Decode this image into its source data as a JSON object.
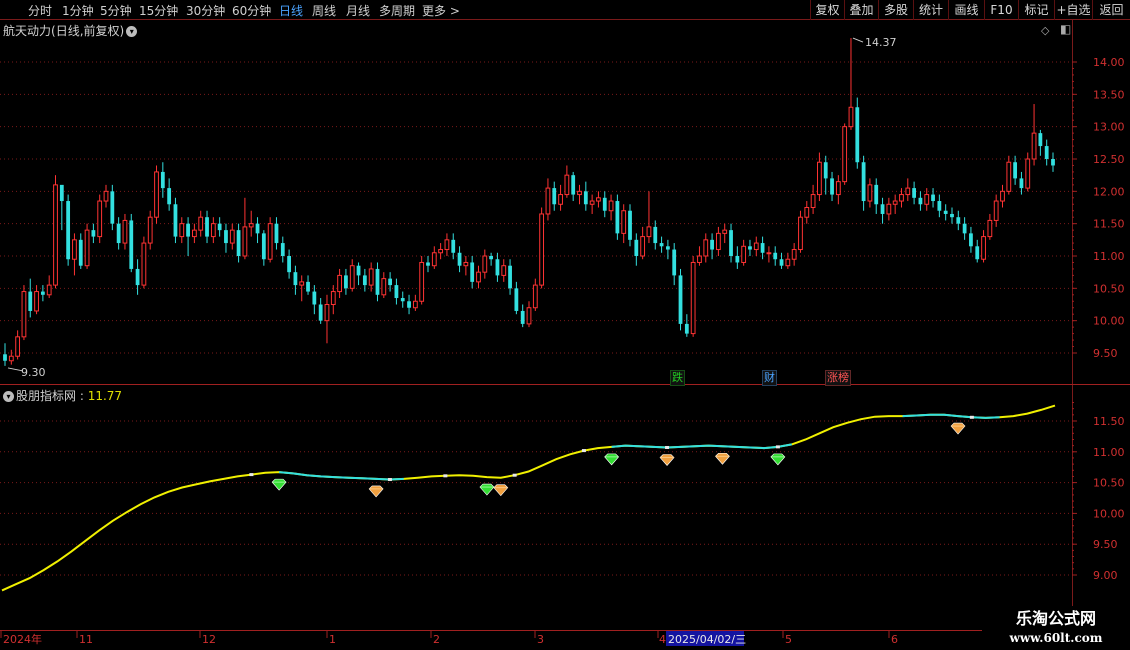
{
  "toolbar": {
    "periods": [
      "分时",
      "1分钟",
      "5分钟",
      "15分钟",
      "30分钟",
      "60分钟",
      "日线",
      "周线",
      "月线",
      "多周期",
      "更多 >"
    ],
    "active_period": "日线",
    "buttons": [
      "复权",
      "叠加",
      "多股",
      "统计",
      "画线",
      "F10",
      "标记",
      "+自选",
      "返回"
    ]
  },
  "main_chart": {
    "stock_name": "航天动力",
    "period_info": "(日线,前复权)",
    "high_label": "14.37",
    "low_label": "9.30",
    "y_ticks": [
      "14.00",
      "13.50",
      "13.00",
      "12.50",
      "12.00",
      "11.50",
      "11.00",
      "10.50",
      "10.00",
      "9.50"
    ],
    "tags": [
      {
        "text": "跌",
        "color": "#22cc22"
      },
      {
        "text": "财",
        "color": "#4aa3ff"
      },
      {
        "text": "涨榜",
        "color": "#ff5555"
      }
    ]
  },
  "indicator": {
    "name": "股朋指标网",
    "value": "11.77",
    "y_ticks": [
      "11.50",
      "11.00",
      "10.50",
      "10.00",
      "9.50",
      "9.00"
    ]
  },
  "x_axis": {
    "labels": [
      "2024年",
      "11",
      "12",
      "1",
      "2",
      "3",
      "4",
      "5",
      "6"
    ],
    "cursor_date": "2025/04/02/三"
  },
  "watermark": {
    "main": "乐淘公式网",
    "url": "www.60lt.com"
  },
  "colors": {
    "up": "#ff3333",
    "down": "#33e0e0",
    "line_yellow": "#f0f000",
    "line_cyan": "#33e0e0",
    "grid": "#7a1a1a"
  },
  "chart_data": {
    "type": "candlestick",
    "price_range": [
      9.2,
      14.6
    ],
    "high": 14.37,
    "low": 9.3,
    "candles": [
      [
        9.48,
        9.38,
        9.65,
        9.3
      ],
      [
        9.38,
        9.45,
        9.55,
        9.32
      ],
      [
        9.45,
        9.75,
        9.85,
        9.4
      ],
      [
        9.75,
        10.45,
        10.55,
        9.7
      ],
      [
        10.45,
        10.15,
        10.65,
        10.05
      ],
      [
        10.15,
        10.45,
        10.55,
        10.1
      ],
      [
        10.45,
        10.4,
        10.55,
        10.3
      ],
      [
        10.4,
        10.55,
        10.7,
        10.35
      ],
      [
        10.55,
        12.1,
        12.25,
        10.5
      ],
      [
        12.1,
        11.85,
        12.0,
        11.4
      ],
      [
        11.85,
        10.95,
        11.95,
        10.85
      ],
      [
        10.95,
        11.25,
        11.35,
        10.7
      ],
      [
        11.25,
        10.85,
        11.35,
        10.8
      ],
      [
        10.85,
        11.4,
        11.5,
        10.8
      ],
      [
        11.4,
        11.3,
        11.5,
        11.2
      ],
      [
        11.3,
        11.85,
        11.95,
        11.2
      ],
      [
        11.85,
        12.0,
        12.1,
        11.75
      ],
      [
        12.0,
        11.5,
        12.1,
        11.4
      ],
      [
        11.5,
        11.2,
        11.6,
        11.1
      ],
      [
        11.2,
        11.55,
        11.65,
        11.1
      ],
      [
        11.55,
        10.8,
        11.65,
        10.75
      ],
      [
        10.8,
        10.55,
        10.95,
        10.4
      ],
      [
        10.55,
        11.2,
        11.3,
        10.5
      ],
      [
        11.2,
        11.6,
        11.7,
        11.1
      ],
      [
        11.6,
        12.3,
        12.4,
        11.5
      ],
      [
        12.3,
        12.05,
        12.45,
        11.9
      ],
      [
        12.05,
        11.8,
        12.2,
        11.7
      ],
      [
        11.8,
        11.3,
        11.9,
        11.2
      ],
      [
        11.3,
        11.5,
        11.6,
        11.2
      ],
      [
        11.5,
        11.3,
        11.6,
        11.0
      ],
      [
        11.3,
        11.4,
        11.5,
        11.2
      ],
      [
        11.4,
        11.6,
        11.7,
        11.3
      ],
      [
        11.6,
        11.3,
        11.7,
        11.2
      ],
      [
        11.3,
        11.5,
        11.6,
        11.2
      ],
      [
        11.5,
        11.4,
        11.6,
        11.3
      ],
      [
        11.4,
        11.2,
        11.5,
        11.05
      ],
      [
        11.2,
        11.4,
        11.5,
        11.1
      ],
      [
        11.4,
        11.0,
        11.5,
        10.9
      ],
      [
        11.0,
        11.45,
        11.9,
        10.95
      ],
      [
        11.45,
        11.5,
        11.7,
        11.3
      ],
      [
        11.5,
        11.35,
        11.6,
        11.2
      ],
      [
        11.35,
        10.95,
        11.4,
        10.85
      ],
      [
        10.95,
        11.5,
        11.6,
        10.9
      ],
      [
        11.5,
        11.2,
        11.6,
        11.1
      ],
      [
        11.2,
        11.0,
        11.3,
        10.9
      ],
      [
        11.0,
        10.75,
        11.1,
        10.65
      ],
      [
        10.75,
        10.55,
        10.85,
        10.4
      ],
      [
        10.55,
        10.6,
        10.7,
        10.3
      ],
      [
        10.6,
        10.45,
        10.7,
        10.4
      ],
      [
        10.45,
        10.25,
        10.55,
        10.1
      ],
      [
        10.25,
        10.0,
        10.35,
        9.95
      ],
      [
        10.0,
        10.25,
        10.4,
        9.65
      ],
      [
        10.25,
        10.45,
        10.55,
        10.1
      ],
      [
        10.45,
        10.7,
        10.8,
        10.35
      ],
      [
        10.7,
        10.5,
        10.8,
        10.4
      ],
      [
        10.5,
        10.85,
        10.95,
        10.45
      ],
      [
        10.85,
        10.7,
        10.9,
        10.55
      ],
      [
        10.7,
        10.55,
        10.8,
        10.45
      ],
      [
        10.55,
        10.8,
        10.9,
        10.45
      ],
      [
        10.8,
        10.4,
        10.9,
        10.3
      ],
      [
        10.4,
        10.65,
        10.75,
        10.35
      ],
      [
        10.65,
        10.55,
        10.75,
        10.45
      ],
      [
        10.55,
        10.35,
        10.65,
        10.25
      ],
      [
        10.35,
        10.3,
        10.45,
        10.2
      ],
      [
        10.3,
        10.2,
        10.4,
        10.1
      ],
      [
        10.2,
        10.3,
        10.4,
        10.15
      ],
      [
        10.3,
        10.9,
        11.0,
        10.25
      ],
      [
        10.9,
        10.85,
        11.0,
        10.75
      ],
      [
        10.85,
        11.05,
        11.15,
        10.8
      ],
      [
        11.05,
        11.1,
        11.2,
        10.95
      ],
      [
        11.1,
        11.25,
        11.35,
        11.0
      ],
      [
        11.25,
        11.05,
        11.35,
        10.95
      ],
      [
        11.05,
        10.85,
        11.15,
        10.75
      ],
      [
        10.85,
        10.9,
        11.0,
        10.7
      ],
      [
        10.9,
        10.6,
        11.0,
        10.5
      ],
      [
        10.6,
        10.75,
        10.85,
        10.5
      ],
      [
        10.75,
        11.0,
        11.1,
        10.65
      ],
      [
        11.0,
        10.95,
        11.05,
        10.85
      ],
      [
        10.95,
        10.7,
        11.05,
        10.6
      ],
      [
        10.7,
        10.85,
        10.95,
        10.6
      ],
      [
        10.85,
        10.5,
        10.95,
        10.4
      ],
      [
        10.5,
        10.15,
        10.6,
        10.1
      ],
      [
        10.15,
        9.95,
        10.25,
        9.9
      ],
      [
        9.95,
        10.2,
        10.3,
        9.9
      ],
      [
        10.2,
        10.55,
        10.65,
        10.15
      ],
      [
        10.55,
        11.65,
        11.75,
        10.5
      ],
      [
        11.65,
        12.05,
        12.2,
        11.55
      ],
      [
        12.05,
        11.8,
        12.15,
        11.7
      ],
      [
        11.8,
        11.95,
        12.1,
        11.7
      ],
      [
        11.95,
        12.25,
        12.4,
        11.9
      ],
      [
        12.25,
        11.95,
        12.3,
        11.85
      ],
      [
        11.95,
        12.0,
        12.1,
        11.8
      ],
      [
        12.0,
        11.8,
        12.15,
        11.7
      ],
      [
        11.8,
        11.85,
        11.95,
        11.65
      ],
      [
        11.85,
        11.9,
        12.0,
        11.75
      ],
      [
        11.9,
        11.7,
        12.0,
        11.6
      ],
      [
        11.7,
        11.85,
        11.95,
        11.55
      ],
      [
        11.85,
        11.35,
        11.95,
        11.25
      ],
      [
        11.35,
        11.7,
        11.8,
        11.2
      ],
      [
        11.7,
        11.25,
        11.8,
        11.15
      ],
      [
        11.25,
        11.0,
        11.35,
        10.85
      ],
      [
        11.0,
        11.3,
        11.45,
        10.95
      ],
      [
        11.3,
        11.45,
        12.0,
        11.2
      ],
      [
        11.45,
        11.2,
        11.55,
        11.1
      ],
      [
        11.2,
        11.15,
        11.3,
        11.05
      ],
      [
        11.15,
        11.1,
        11.25,
        10.95
      ],
      [
        11.1,
        10.7,
        11.2,
        10.55
      ],
      [
        10.7,
        9.95,
        10.8,
        9.85
      ],
      [
        9.95,
        9.8,
        10.1,
        9.75
      ],
      [
        9.8,
        10.9,
        11.0,
        9.75
      ],
      [
        10.9,
        11.0,
        11.15,
        10.85
      ],
      [
        11.0,
        11.25,
        11.35,
        10.9
      ],
      [
        11.25,
        11.1,
        11.35,
        10.95
      ],
      [
        11.1,
        11.35,
        11.45,
        11.0
      ],
      [
        11.35,
        11.4,
        11.5,
        11.2
      ],
      [
        11.4,
        11.0,
        11.5,
        10.9
      ],
      [
        11.0,
        10.9,
        11.15,
        10.8
      ],
      [
        10.9,
        11.15,
        11.25,
        10.85
      ],
      [
        11.15,
        11.1,
        11.25,
        11.0
      ],
      [
        11.1,
        11.2,
        11.3,
        11.0
      ],
      [
        11.2,
        11.05,
        11.3,
        10.95
      ],
      [
        11.05,
        11.05,
        11.15,
        10.9
      ],
      [
        11.05,
        10.95,
        11.15,
        10.85
      ],
      [
        10.95,
        10.85,
        11.05,
        10.8
      ],
      [
        10.85,
        10.95,
        11.05,
        10.8
      ],
      [
        10.95,
        11.1,
        11.2,
        10.85
      ],
      [
        11.1,
        11.6,
        11.7,
        11.05
      ],
      [
        11.6,
        11.75,
        11.85,
        11.5
      ],
      [
        11.75,
        11.95,
        12.1,
        11.65
      ],
      [
        11.95,
        12.45,
        12.6,
        11.85
      ],
      [
        12.45,
        12.2,
        12.55,
        11.95
      ],
      [
        12.2,
        11.95,
        12.3,
        11.85
      ],
      [
        11.95,
        12.15,
        12.25,
        11.8
      ],
      [
        12.15,
        13.0,
        13.05,
        12.1
      ],
      [
        13.0,
        13.3,
        14.37,
        12.95
      ],
      [
        13.3,
        12.45,
        13.45,
        12.35
      ],
      [
        12.45,
        11.85,
        12.55,
        11.7
      ],
      [
        11.85,
        12.1,
        12.2,
        11.75
      ],
      [
        12.1,
        11.8,
        12.2,
        11.65
      ],
      [
        11.8,
        11.65,
        11.9,
        11.5
      ],
      [
        11.65,
        11.8,
        11.9,
        11.55
      ],
      [
        11.8,
        11.85,
        11.95,
        11.65
      ],
      [
        11.85,
        11.95,
        12.05,
        11.75
      ],
      [
        11.95,
        12.05,
        12.2,
        11.85
      ],
      [
        12.05,
        11.9,
        12.15,
        11.8
      ],
      [
        11.9,
        11.8,
        12.0,
        11.7
      ],
      [
        11.8,
        11.95,
        12.05,
        11.7
      ],
      [
        11.95,
        11.85,
        12.05,
        11.75
      ],
      [
        11.85,
        11.7,
        11.95,
        11.6
      ],
      [
        11.7,
        11.65,
        11.8,
        11.55
      ],
      [
        11.65,
        11.6,
        11.75,
        11.5
      ],
      [
        11.6,
        11.5,
        11.7,
        11.4
      ],
      [
        11.5,
        11.35,
        11.6,
        11.25
      ],
      [
        11.35,
        11.15,
        11.45,
        11.05
      ],
      [
        11.15,
        10.95,
        11.25,
        10.9
      ],
      [
        10.95,
        11.3,
        11.4,
        10.9
      ],
      [
        11.3,
        11.55,
        11.65,
        11.25
      ],
      [
        11.55,
        11.85,
        11.95,
        11.45
      ],
      [
        11.85,
        12.0,
        12.1,
        11.75
      ],
      [
        12.0,
        12.45,
        12.55,
        11.95
      ],
      [
        12.45,
        12.2,
        12.55,
        12.1
      ],
      [
        12.2,
        12.05,
        12.3,
        11.95
      ],
      [
        12.05,
        12.5,
        12.6,
        12.0
      ],
      [
        12.5,
        12.9,
        13.35,
        12.4
      ],
      [
        12.9,
        12.7,
        12.95,
        12.55
      ],
      [
        12.7,
        12.5,
        12.8,
        12.4
      ],
      [
        12.5,
        12.4,
        12.6,
        12.3
      ]
    ],
    "indicator_range": [
      8.6,
      12.0
    ],
    "indicator_line": [
      8.75,
      8.85,
      8.95,
      9.08,
      9.22,
      9.38,
      9.55,
      9.72,
      9.88,
      10.02,
      10.15,
      10.26,
      10.35,
      10.42,
      10.47,
      10.52,
      10.56,
      10.6,
      10.63,
      10.66,
      10.67,
      10.65,
      10.62,
      10.6,
      10.59,
      10.58,
      10.57,
      10.56,
      10.55,
      10.56,
      10.58,
      10.6,
      10.61,
      10.62,
      10.61,
      10.59,
      10.58,
      10.62,
      10.68,
      10.78,
      10.88,
      10.96,
      11.02,
      11.06,
      11.08,
      11.1,
      11.09,
      11.08,
      11.07,
      11.08,
      11.09,
      11.1,
      11.09,
      11.08,
      11.07,
      11.06,
      11.08,
      11.12,
      11.2,
      11.3,
      11.4,
      11.47,
      11.53,
      11.57,
      11.58,
      11.58,
      11.59,
      11.6,
      11.6,
      11.58,
      11.56,
      11.55,
      11.56,
      11.58,
      11.62,
      11.68,
      11.75
    ],
    "line_cyan_segments": [
      [
        20,
        29
      ],
      [
        44,
        57
      ],
      [
        65,
        72
      ]
    ],
    "buy_signals": [
      20,
      35,
      44,
      56
    ],
    "sell_signals": [
      27,
      36,
      48,
      52,
      69
    ],
    "signal_markers_index_space": "indicator_line index"
  }
}
